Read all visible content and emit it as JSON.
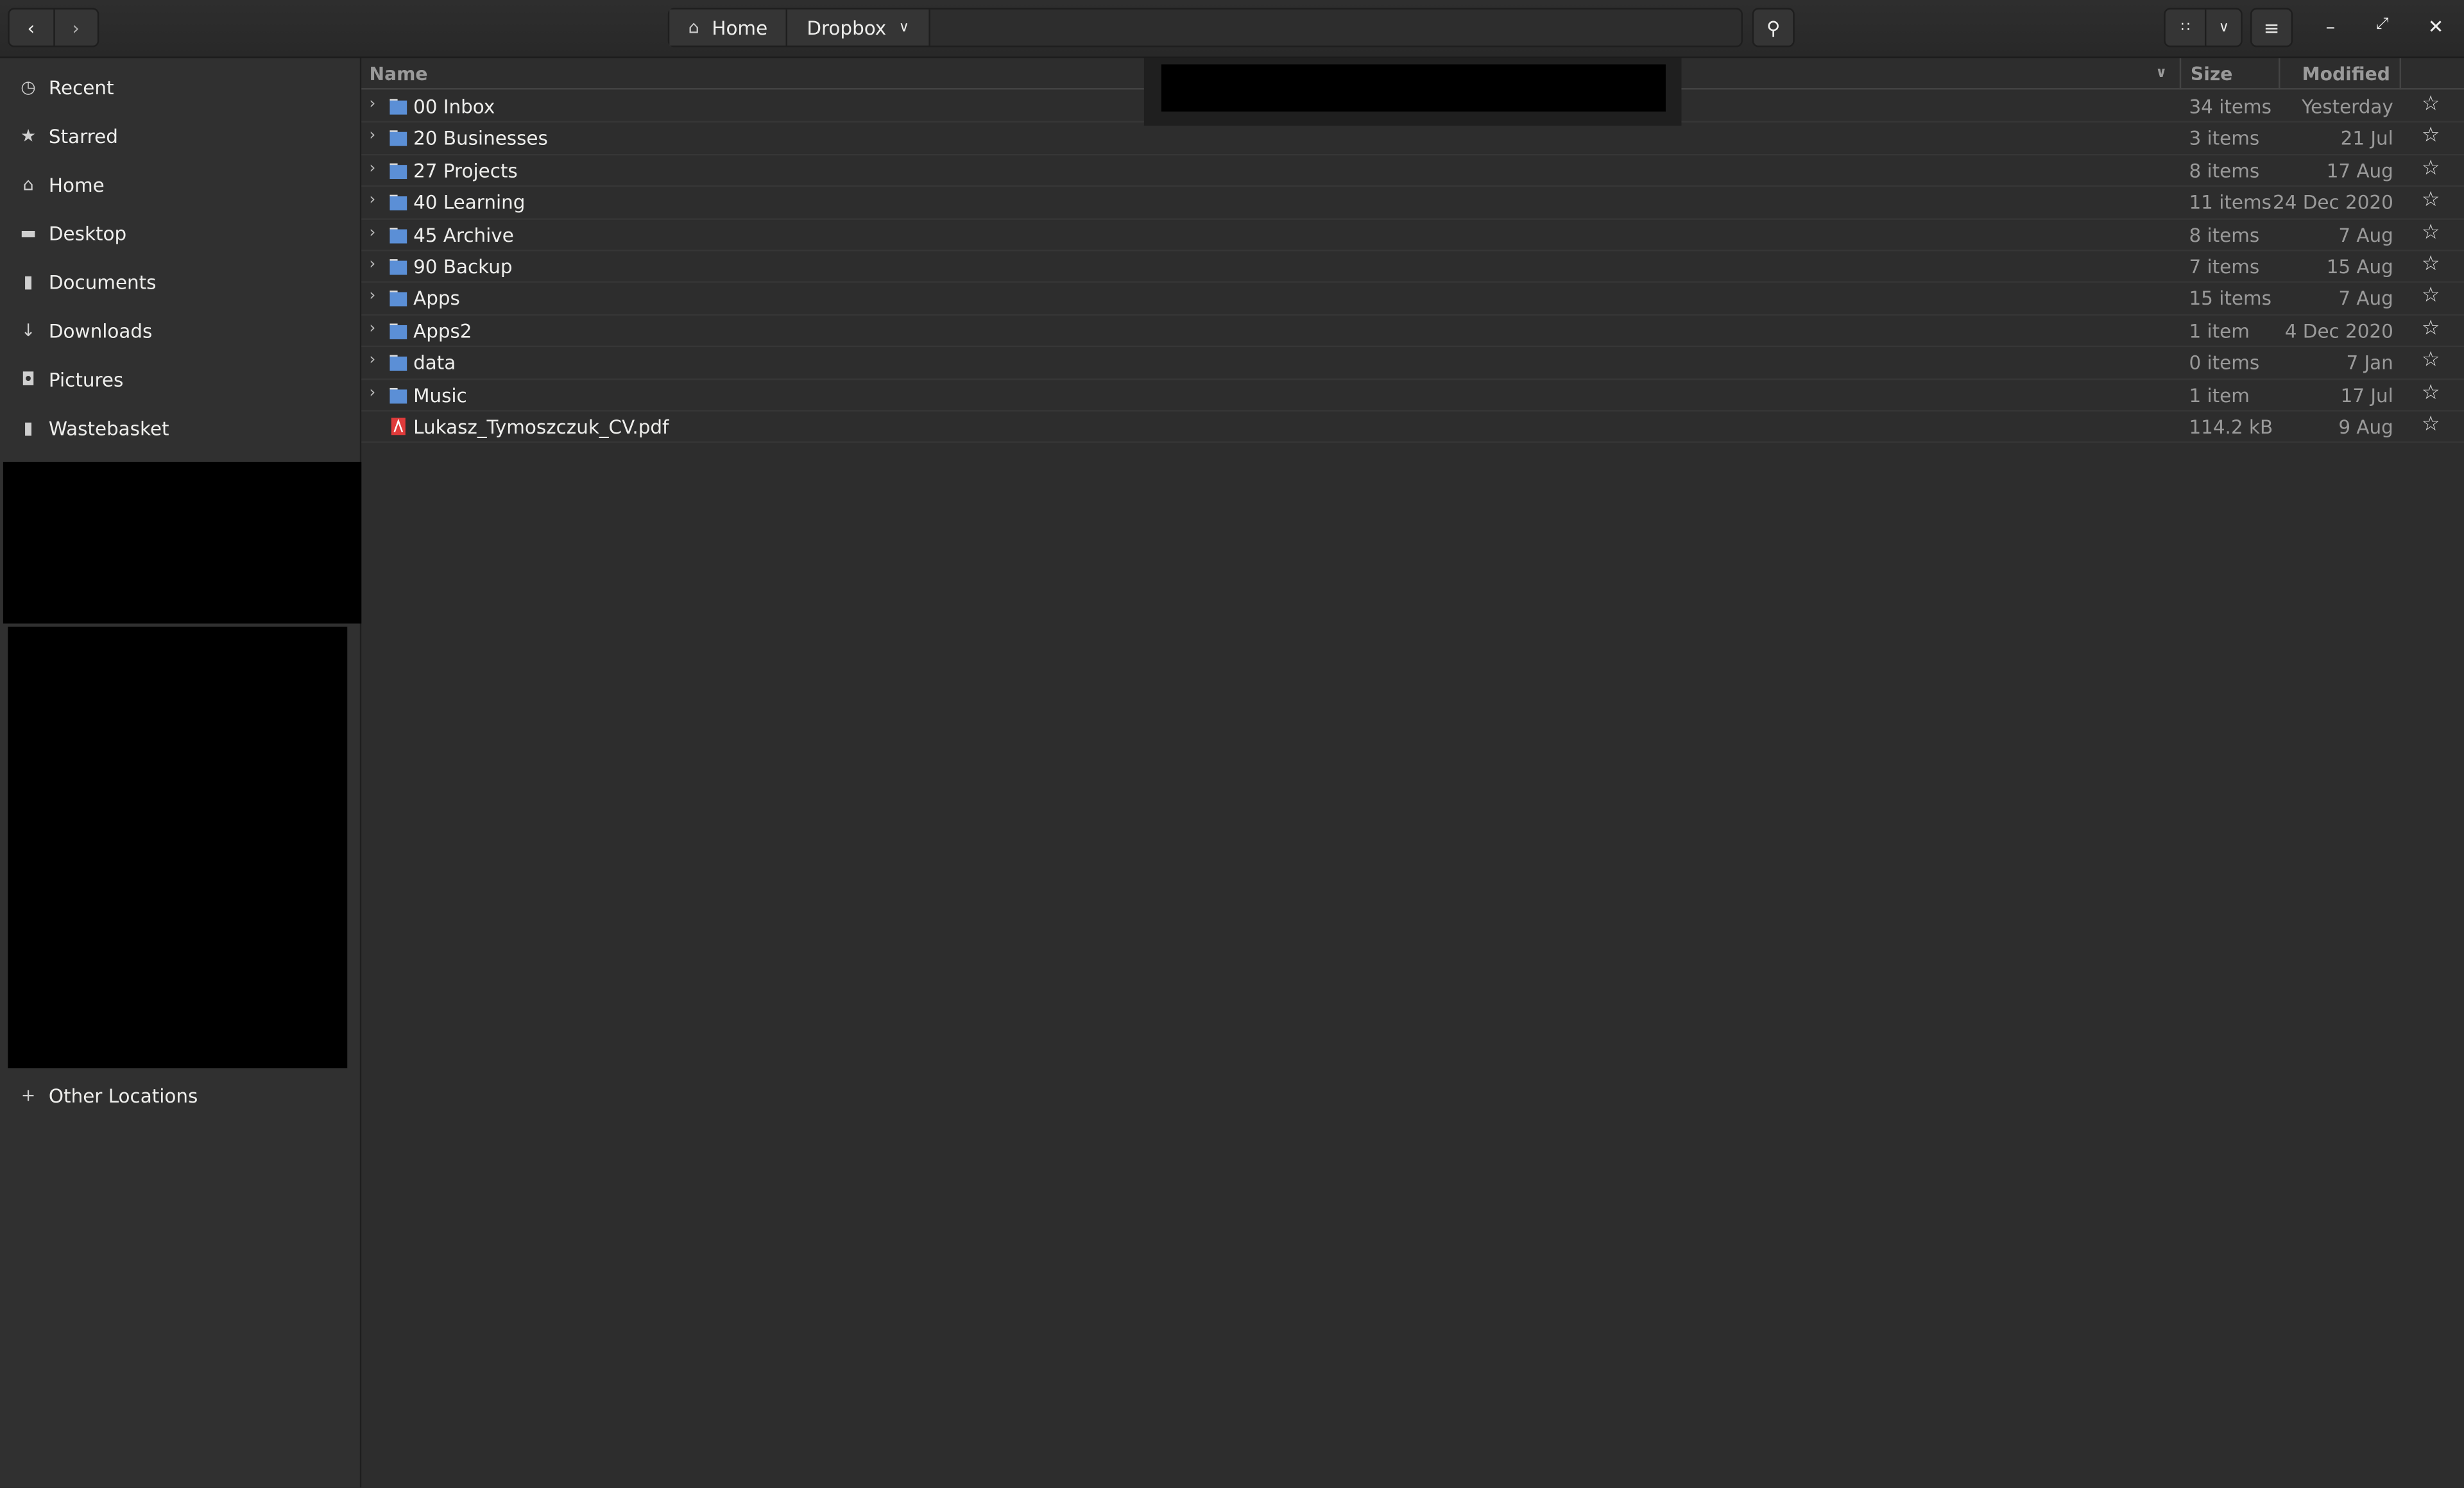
{
  "header": {
    "back_icon": "chevron-left-icon",
    "forward_icon": "chevron-right-icon",
    "breadcrumbs": [
      {
        "label": "Home",
        "icon": "home-icon"
      },
      {
        "label": "Dropbox",
        "icon": "chevron-down-icon"
      }
    ],
    "search_icon": "search-icon",
    "view_icon": "grid-icon",
    "menu_icon": "hamburger-icon"
  },
  "sidebar": {
    "items": [
      {
        "label": "Recent",
        "icon": "clock-icon"
      },
      {
        "label": "Starred",
        "icon": "star-icon"
      },
      {
        "label": "Home",
        "icon": "home-icon"
      },
      {
        "label": "Desktop",
        "icon": "desktop-icon"
      },
      {
        "label": "Documents",
        "icon": "document-icon"
      },
      {
        "label": "Downloads",
        "icon": "download-icon"
      },
      {
        "label": "Pictures",
        "icon": "camera-icon"
      },
      {
        "label": "Wastebasket",
        "icon": "trash-icon"
      }
    ],
    "other_locations": "Other Locations"
  },
  "columns": {
    "name": "Name",
    "size": "Size",
    "modified": "Modified"
  },
  "files": [
    {
      "name": "00 Inbox",
      "size": "34 items",
      "modified": "Yesterday",
      "type": "folder"
    },
    {
      "name": "20 Businesses",
      "size": "3 items",
      "modified": "21 Jul",
      "type": "folder"
    },
    {
      "name": "27 Projects",
      "size": "8 items",
      "modified": "17 Aug",
      "type": "folder"
    },
    {
      "name": "40 Learning",
      "size": "11 items",
      "modified": "24 Dec 2020",
      "type": "folder"
    },
    {
      "name": "45 Archive",
      "size": "8 items",
      "modified": "7 Aug",
      "type": "folder"
    },
    {
      "name": "90 Backup",
      "size": "7 items",
      "modified": "15 Aug",
      "type": "folder"
    },
    {
      "name": "Apps",
      "size": "15 items",
      "modified": "7 Aug",
      "type": "folder"
    },
    {
      "name": "Apps2",
      "size": "1 item",
      "modified": "4 Dec 2020",
      "type": "folder"
    },
    {
      "name": "data",
      "size": "0 items",
      "modified": "7 Jan",
      "type": "folder"
    },
    {
      "name": "Music",
      "size": "1 item",
      "modified": "17 Jul",
      "type": "folder"
    },
    {
      "name": "Lukasz_Tymoszczuk_CV.pdf",
      "size": "114.2 kB",
      "modified": "9 Aug",
      "type": "pdf"
    }
  ],
  "colors": {
    "folder": "#5b8fd6",
    "pdf": "#e03b3b",
    "background": "#2d2d2d",
    "sidebar": "#303030"
  }
}
